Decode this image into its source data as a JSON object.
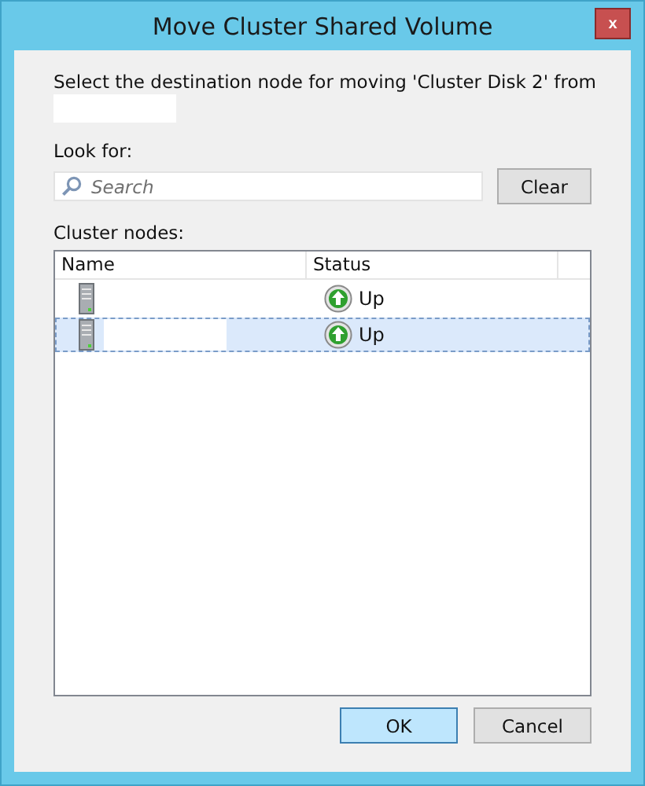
{
  "window": {
    "title": "Move Cluster Shared Volume",
    "close": "x"
  },
  "prompt": "Select the destination node for moving 'Cluster Disk 2' from",
  "search": {
    "label": "Look for:",
    "placeholder": "Search",
    "clear": "Clear"
  },
  "nodes": {
    "label": "Cluster nodes:",
    "columns": [
      "Name",
      "Status"
    ],
    "rows": [
      {
        "status": "Up",
        "selected": false
      },
      {
        "status": "Up",
        "selected": true
      }
    ]
  },
  "buttons": [
    {
      "label": "OK",
      "default": true
    },
    {
      "label": "Cancel",
      "default": false
    }
  ]
}
